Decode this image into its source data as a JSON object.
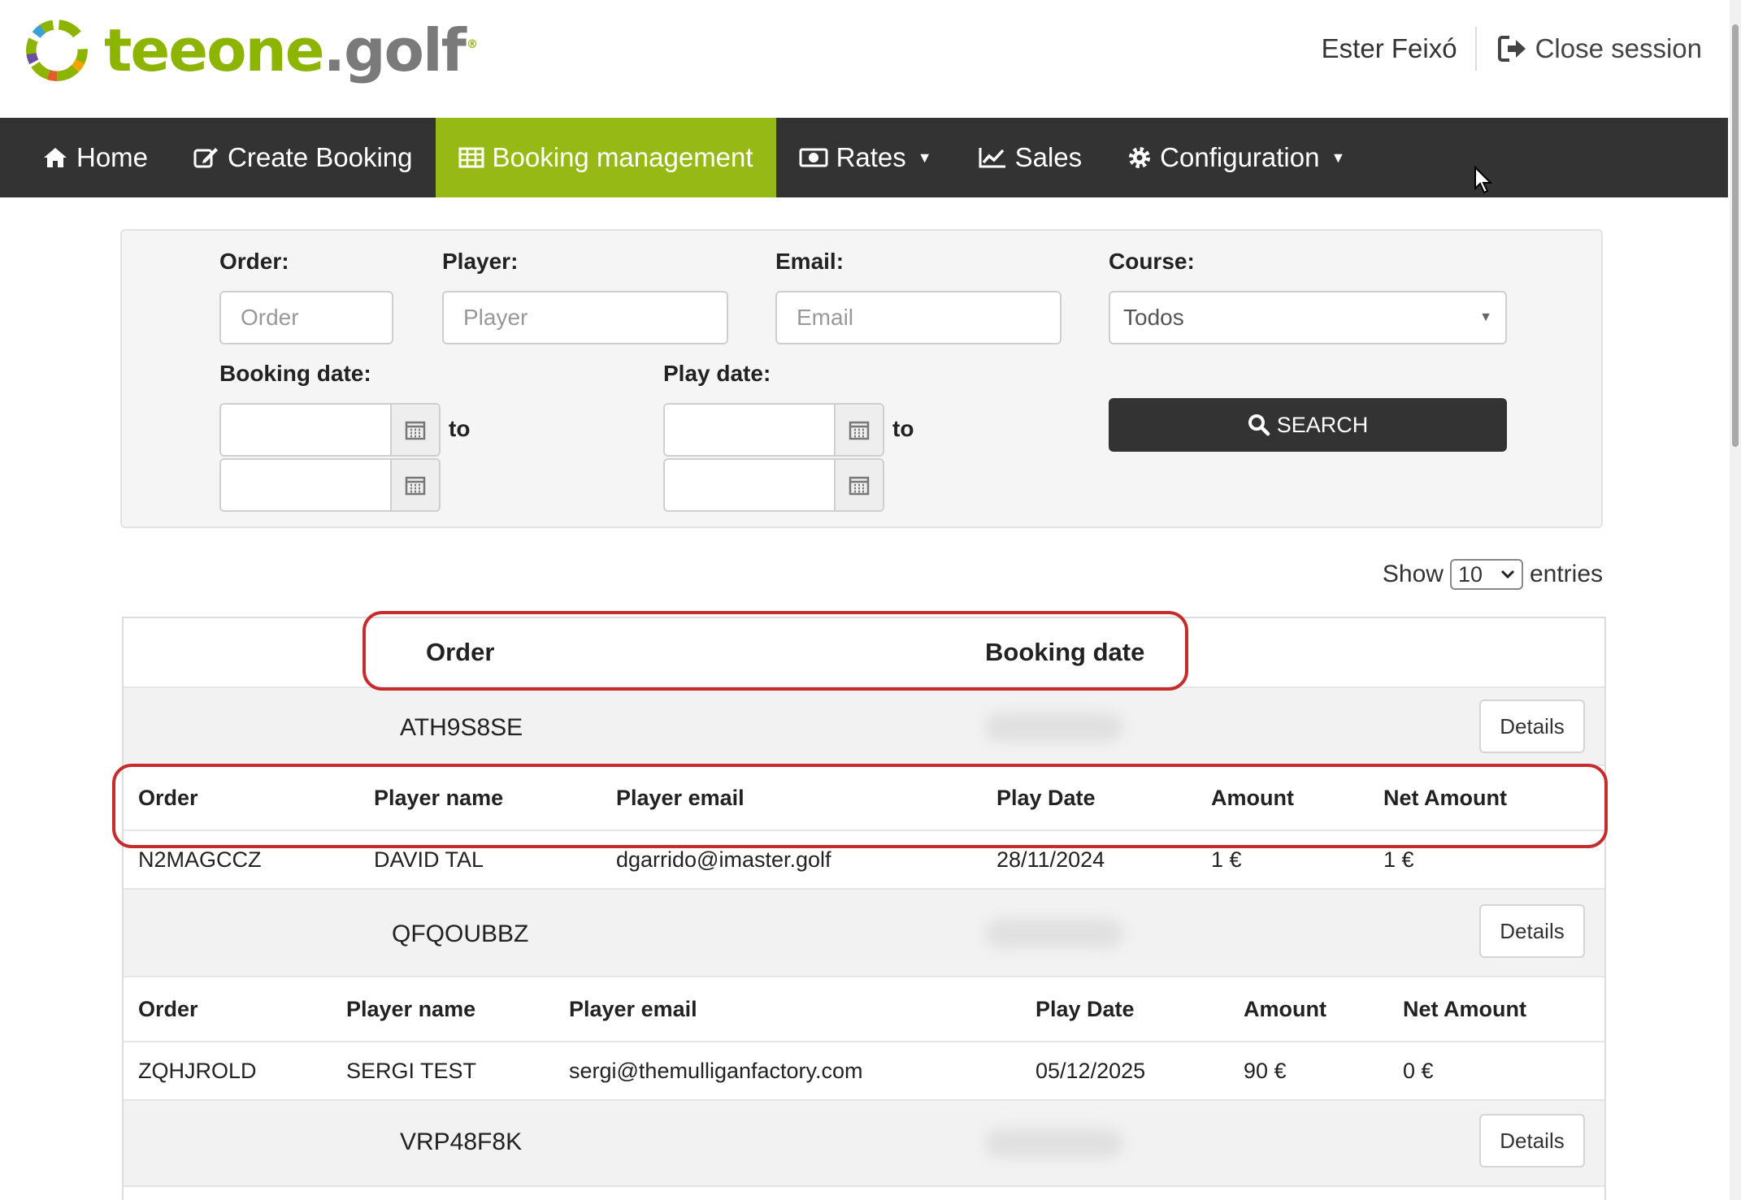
{
  "brand": {
    "logo_text_a": "teeone",
    "logo_text_b": ".golf",
    "logo_reg": "®"
  },
  "header": {
    "user_name": "Ester Feixó",
    "logout_label": "Close session"
  },
  "nav": {
    "items": [
      {
        "label": "Home",
        "icon": "home-icon"
      },
      {
        "label": "Create Booking",
        "icon": "edit-icon"
      },
      {
        "label": "Booking management",
        "icon": "table-icon",
        "active": true
      },
      {
        "label": "Rates",
        "icon": "money-icon",
        "dropdown": true
      },
      {
        "label": "Sales",
        "icon": "chart-line-icon"
      },
      {
        "label": "Configuration",
        "icon": "gear-icon",
        "dropdown": true
      }
    ]
  },
  "filters": {
    "order_label": "Order:",
    "order_placeholder": "Order",
    "player_label": "Player:",
    "player_placeholder": "Player",
    "email_label": "Email:",
    "email_placeholder": "Email",
    "course_label": "Course:",
    "course_value": "Todos",
    "booking_date_label": "Booking date:",
    "play_date_label": "Play date:",
    "to_label": "to",
    "search_label": "SEARCH"
  },
  "entries": {
    "show_label": "Show",
    "value": "10",
    "entries_label": "entries"
  },
  "table": {
    "header": {
      "order": "Order",
      "booking_date": "Booking date"
    },
    "details_label": "Details",
    "sub_headers": {
      "order": "Order",
      "player_name": "Player name",
      "player_email": "Player email",
      "play_date": "Play Date",
      "amount": "Amount",
      "net_amount": "Net Amount"
    },
    "orders": [
      {
        "code": "ATH9S8SE",
        "lines": [
          {
            "order": "N2MAGCCZ",
            "player_name": "DAVID TAL",
            "player_email": "dgarrido@imaster.golf",
            "play_date": "28/11/2024",
            "amount": "1 €",
            "net_amount": "1 €"
          }
        ]
      },
      {
        "code": "QFQOUBBZ",
        "lines": [
          {
            "order": "ZQHJROLD",
            "player_name": "SERGI TEST",
            "player_email": "sergi@themulliganfactory.com",
            "play_date": "05/12/2025",
            "amount": "90 €",
            "net_amount": "0 €"
          }
        ]
      },
      {
        "code": "VRP48F8K",
        "lines": []
      }
    ]
  },
  "colors": {
    "accent": "#97b915",
    "nav_bg": "#333333",
    "highlight": "#c62c2c"
  }
}
